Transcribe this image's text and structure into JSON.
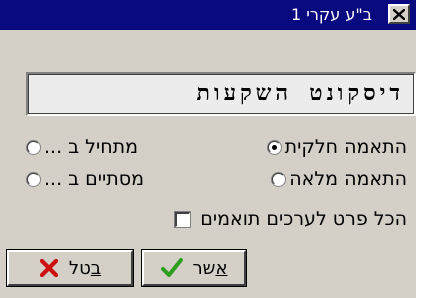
{
  "window": {
    "title": "ב\"ע עקרי 1",
    "close_label": "X"
  },
  "heading": {
    "text": "דיסקונט השקעות"
  },
  "options": {
    "match_partial": {
      "label": "התאמה חלקית",
      "selected": true
    },
    "match_full": {
      "label": "התאמה מלאה",
      "selected": false
    },
    "starts_with": {
      "label": "מתחיל ב ...",
      "selected": false
    },
    "ends_with": {
      "label": "מסתיים ב ...",
      "selected": false
    }
  },
  "checkbox": {
    "label": "הכל פרט לערכים תואמים",
    "checked": false
  },
  "buttons": {
    "ok_label_rest": "שר",
    "ok_label_underlined": "א",
    "cancel_label_rest": "טל",
    "cancel_label_underlined": "ב"
  },
  "colors": {
    "titlebar": "#0a0a80",
    "dialog_bg": "#d4d0c8",
    "ok_icon": "#2e9e1e",
    "cancel_icon": "#cc1111"
  },
  "icons": {
    "ok": "checkmark-icon",
    "cancel": "x-mark-icon",
    "close": "close-icon"
  }
}
